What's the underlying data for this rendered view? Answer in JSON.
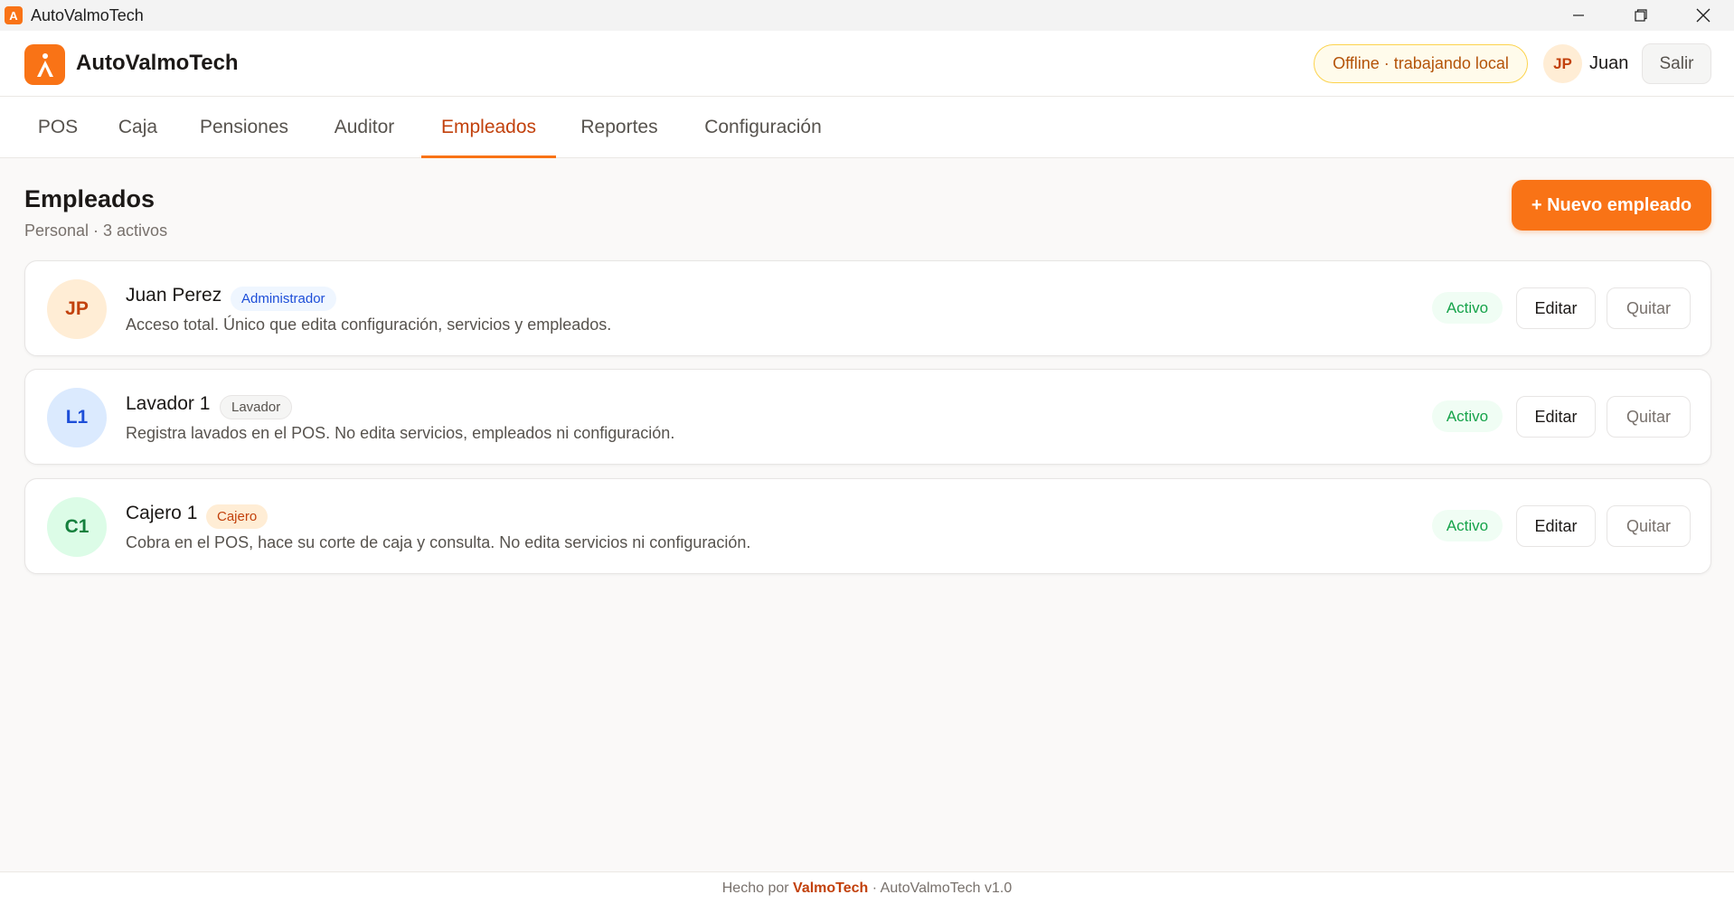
{
  "window": {
    "title": "AutoValmoTech"
  },
  "header": {
    "brand": "AutoValmoTech",
    "status_badge": "Offline · trabajando local",
    "user_initials": "JP",
    "user_name": "Juan",
    "logout_label": "Salir"
  },
  "tabs": [
    {
      "label": "POS",
      "active": false
    },
    {
      "label": "Caja",
      "active": false
    },
    {
      "label": "Pensiones",
      "active": false
    },
    {
      "label": "Auditor",
      "active": false
    },
    {
      "label": "Empleados",
      "active": true
    },
    {
      "label": "Reportes",
      "active": false
    },
    {
      "label": "Configuración",
      "active": false
    }
  ],
  "page": {
    "title": "Empleados",
    "subtitle": "Personal · 3 activos",
    "new_button": "+ Nuevo empleado"
  },
  "employees": [
    {
      "initials": "JP",
      "name": "Juan Perez",
      "role": "Administrador",
      "description": "Acceso total. Único que edita configuración, servicios y empleados.",
      "status": "Activo",
      "edit_label": "Editar",
      "remove_label": "Quitar"
    },
    {
      "initials": "L1",
      "name": "Lavador 1",
      "role": "Lavador",
      "description": "Registra lavados en el POS. No edita servicios, empleados ni configuración.",
      "status": "Activo",
      "edit_label": "Editar",
      "remove_label": "Quitar"
    },
    {
      "initials": "C1",
      "name": "Cajero 1",
      "role": "Cajero",
      "description": "Cobra en el POS, hace su corte de caja y consulta. No edita servicios ni configuración.",
      "status": "Activo",
      "edit_label": "Editar",
      "remove_label": "Quitar"
    }
  ],
  "footer": {
    "prefix": "Hecho por",
    "company": "ValmoTech",
    "suffix": "· AutoValmoTech v1.0"
  },
  "colors": {
    "accent": "#f97316",
    "accent_text": "#c2410c",
    "success": "#16a34a",
    "admin_badge_bg": "#eff6ff",
    "admin_badge_text": "#1d4ed8",
    "washer_badge_bg": "#f5f5f4",
    "cashier_badge_bg": "#ffedd5"
  }
}
